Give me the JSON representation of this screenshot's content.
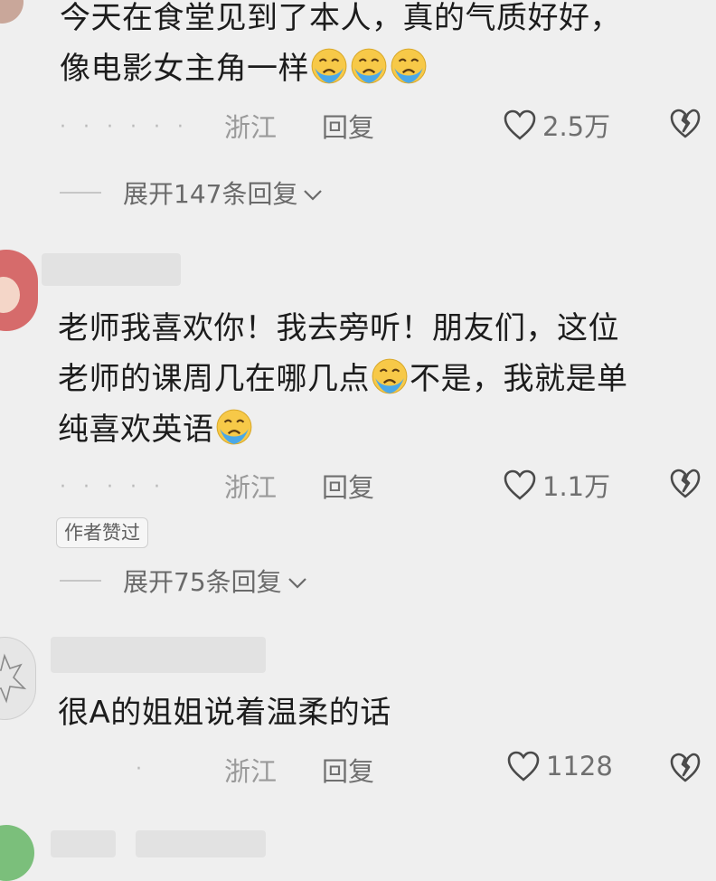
{
  "comments": [
    {
      "lines": [
        "今天在食堂见到了本人，真的气质好好，",
        "像电影女主角一样"
      ],
      "trailing_emoji_count": 3,
      "location": "浙江",
      "reply_label": "回复",
      "likes": "2.5万",
      "expand_label": "展开147条回复"
    },
    {
      "lines": [
        "老师我喜欢你！我去旁听！朋友们，这位",
        "老师的课周几在哪几点",
        "不是，我就是单",
        "纯喜欢英语"
      ],
      "location": "浙江",
      "reply_label": "回复",
      "likes": "1.1万",
      "author_badge": "作者赞过",
      "expand_label": "展开75条回复"
    },
    {
      "lines": [
        "很A的姐姐说着温柔的话"
      ],
      "location": "浙江",
      "reply_label": "回复",
      "likes": "1128"
    }
  ],
  "icons": {
    "emoji": "crying-face-icon",
    "like": "heart-outline-icon",
    "dislike": "broken-heart-icon",
    "expand": "chevron-down-icon"
  },
  "colors": {
    "background": "#efefef",
    "text": "#1c1c1c",
    "muted": "#6f6f6f",
    "location": "#9a9a9a",
    "emoji_face": "#f7c948",
    "emoji_tears": "#4aa8e8"
  }
}
